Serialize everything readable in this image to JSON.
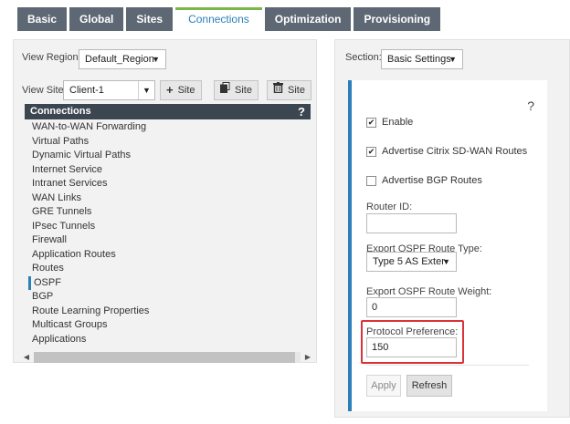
{
  "tabs": [
    {
      "label": "Basic"
    },
    {
      "label": "Global"
    },
    {
      "label": "Sites"
    },
    {
      "label": "Connections",
      "active": true
    },
    {
      "label": "Optimization"
    },
    {
      "label": "Provisioning"
    }
  ],
  "left": {
    "view_region_label": "View Region:",
    "view_region_value": "Default_Region",
    "view_site_label": "View Site:",
    "view_site_value": "Client-1",
    "add_site_label": "Site",
    "clone_site_label": "Site",
    "delete_site_label": "Site",
    "list_header": "Connections",
    "list_help": "?",
    "items": [
      "WAN-to-WAN Forwarding",
      "Virtual Paths",
      "Dynamic Virtual Paths",
      "Internet Service",
      "Intranet Services",
      "WAN Links",
      "GRE Tunnels",
      "IPsec Tunnels",
      "Firewall",
      "Application Routes",
      "Routes",
      "OSPF",
      "BGP",
      "Route Learning Properties",
      "Multicast Groups",
      "Applications"
    ],
    "active_item": "OSPF"
  },
  "right": {
    "section_label": "Section:",
    "section_value": "Basic Settings",
    "help": "?",
    "enable_label": "Enable",
    "enable_checked": true,
    "advertise_sdwan_label": "Advertise Citrix SD-WAN Routes",
    "advertise_sdwan_checked": true,
    "advertise_bgp_label": "Advertise BGP Routes",
    "advertise_bgp_checked": false,
    "router_id_label": "Router ID:",
    "router_id_value": "",
    "route_type_label": "Export OSPF Route Type:",
    "route_type_value": "Type 5 AS Exter",
    "route_weight_label": "Export OSPF Route Weight:",
    "route_weight_value": "0",
    "protocol_pref_label": "Protocol Preference:",
    "protocol_pref_value": "150",
    "apply_label": "Apply",
    "refresh_label": "Refresh"
  },
  "colors": {
    "tab_bg": "#5d6874",
    "active_tab_text": "#2c7fb8",
    "active_tab_top": "#7ab648",
    "list_header_bg": "#3c4651",
    "card_accent": "#2c7fb8",
    "highlight_border": "#d9343a"
  }
}
